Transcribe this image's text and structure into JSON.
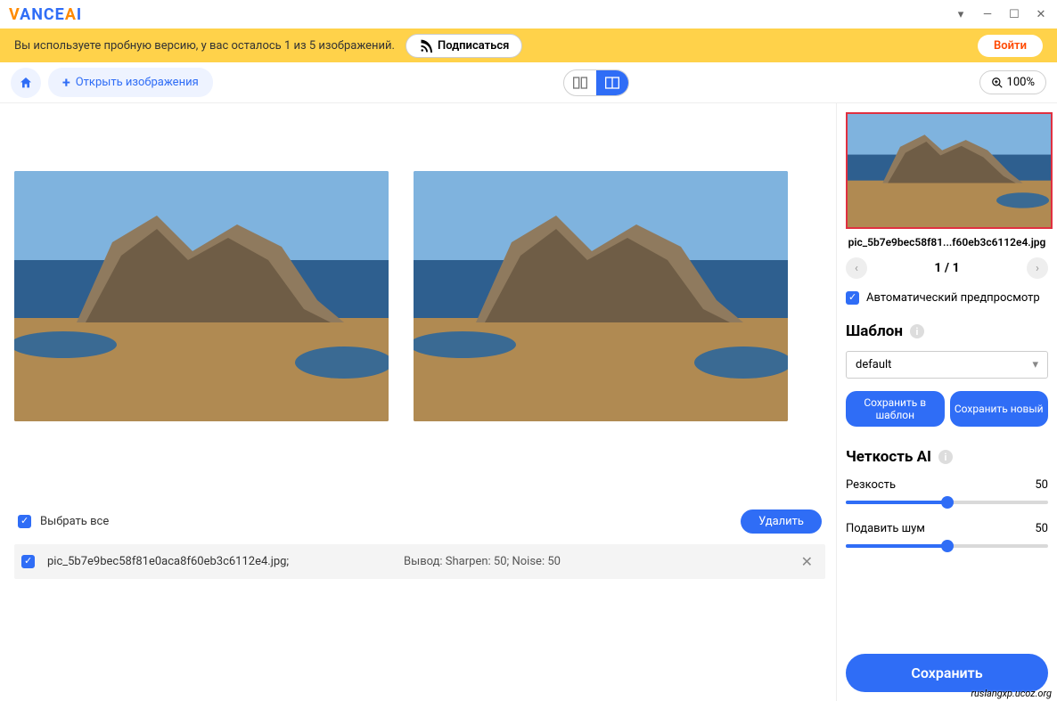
{
  "header": {
    "logo_text": "VANCEAI"
  },
  "banner": {
    "trial_text": "Вы используете пробную версию, у вас осталось 1 из 5 изображений.",
    "subscribe_label": "Подписаться",
    "login_label": "Войти"
  },
  "toolbar": {
    "open_label": "Открыть изображения",
    "zoom_label": "100%"
  },
  "filelist": {
    "select_all_label": "Выбрать все",
    "delete_label": "Удалить",
    "rows": [
      {
        "name": "pic_5b7e9bec58f81e0aca8f60eb3c6112e4.jpg;",
        "output": "Вывод: Sharpen: 50; Noise: 50"
      }
    ]
  },
  "sidebar": {
    "thumb_name": "pic_5b7e9bec58f81...f60eb3c6112e4.jpg",
    "page_current": "1",
    "page_sep": " / ",
    "page_total": "1",
    "auto_preview_label": "Автоматический предпросмотр",
    "template_title": "Шаблон",
    "template_select": "default",
    "save_template_label": "Сохранить в шаблон",
    "save_new_label": "Сохранить новый",
    "sharpness_title": "Четкость AI",
    "sharpness_label": "Резкость",
    "sharpness_value": "50",
    "denoise_label": "Подавить шум",
    "denoise_value": "50",
    "save_label": "Сохранить"
  },
  "watermark": "ruslangxp.ucoz.org"
}
